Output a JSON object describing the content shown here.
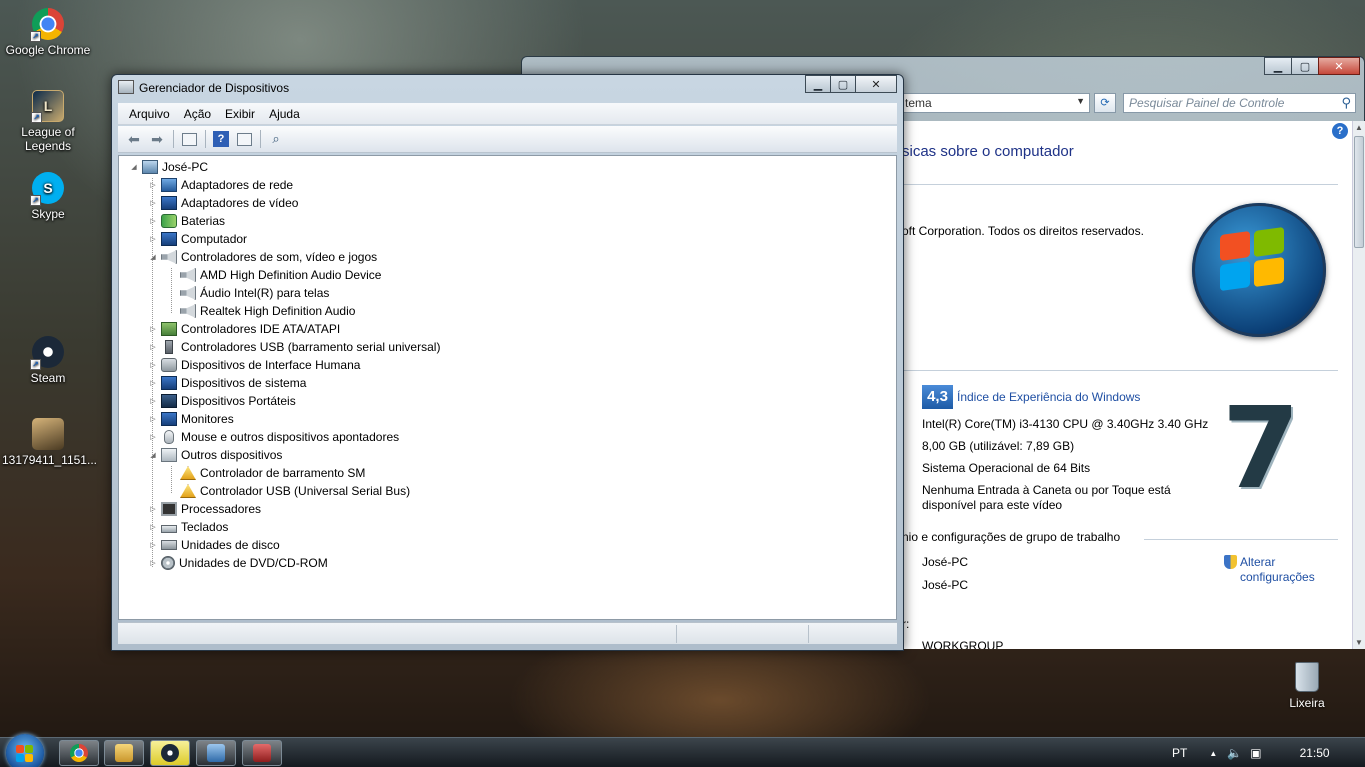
{
  "desktop": {
    "icons": [
      {
        "label": "Google Chrome",
        "icon": "chrome-icon"
      },
      {
        "label": "League of Legends",
        "icon": "league-of-legends-icon"
      },
      {
        "label": "Skype",
        "icon": "skype-icon"
      },
      {
        "label": "Steam",
        "icon": "steam-icon"
      },
      {
        "label": "13179411_1151...",
        "icon": "image-file-icon"
      }
    ],
    "recycle_bin": {
      "label": "Lixeira",
      "icon": "recycle-bin-icon"
    }
  },
  "system_window": {
    "address": "tema",
    "search_placeholder": "Pesquisar Painel de Controle",
    "heading": "sicas sobre o computador",
    "copyright": "oft Corporation. Todos os direitos reservados.",
    "wei_score": "4,3",
    "wei_link": "Índice de Experiência do Windows",
    "processor": "Intel(R) Core(TM) i3-4130 CPU @ 3.40GHz   3.40 GHz",
    "memory": "8,00 GB (utilizável: 7,89 GB)",
    "system_type": "Sistema Operacional de 64 Bits",
    "pen_touch_line1": "Nenhuma Entrada à Caneta ou por Toque está",
    "pen_touch_line2": "disponível para este vídeo",
    "group_section": "nio e configurações de grupo de trabalho",
    "computer_name": "José-PC",
    "full_name": "José-PC",
    "change_settings_line1": "Alterar",
    "change_settings_line2": "configurações",
    "workgroup_label": "r:",
    "workgroup": "WORKGROUP",
    "help_icon": "help-icon"
  },
  "device_manager": {
    "title": "Gerenciador de Dispositivos",
    "menu": [
      "Arquivo",
      "Ação",
      "Exibir",
      "Ajuda"
    ],
    "tree_root": "José-PC",
    "categories": [
      {
        "label": "Adaptadores de rede",
        "icon": "network-adapter-icon",
        "expanded": false
      },
      {
        "label": "Adaptadores de vídeo",
        "icon": "display-adapter-icon",
        "expanded": false
      },
      {
        "label": "Baterias",
        "icon": "battery-icon",
        "expanded": false
      },
      {
        "label": "Computador",
        "icon": "computer-icon",
        "expanded": false
      },
      {
        "label": "Controladores de som, vídeo e jogos",
        "icon": "speaker-icon",
        "expanded": true,
        "children": [
          {
            "label": "AMD High Definition Audio Device",
            "icon": "speaker-icon"
          },
          {
            "label": "Áudio Intel(R) para telas",
            "icon": "speaker-icon"
          },
          {
            "label": "Realtek High Definition Audio",
            "icon": "speaker-icon"
          }
        ]
      },
      {
        "label": "Controladores IDE ATA/ATAPI",
        "icon": "ide-controller-icon",
        "expanded": false
      },
      {
        "label": "Controladores USB (barramento serial universal)",
        "icon": "usb-icon",
        "expanded": false
      },
      {
        "label": "Dispositivos de Interface Humana",
        "icon": "hid-icon",
        "expanded": false
      },
      {
        "label": "Dispositivos de sistema",
        "icon": "system-device-icon",
        "expanded": false
      },
      {
        "label": "Dispositivos Portáteis",
        "icon": "portable-device-icon",
        "expanded": false
      },
      {
        "label": "Monitores",
        "icon": "monitor-icon",
        "expanded": false
      },
      {
        "label": "Mouse e outros dispositivos apontadores",
        "icon": "mouse-icon",
        "expanded": false
      },
      {
        "label": "Outros dispositivos",
        "icon": "unknown-device-icon",
        "expanded": true,
        "children": [
          {
            "label": "Controlador de barramento SM",
            "icon": "warning-device-icon"
          },
          {
            "label": "Controlador USB (Universal Serial Bus)",
            "icon": "warning-device-icon"
          }
        ]
      },
      {
        "label": "Processadores",
        "icon": "processor-icon",
        "expanded": false
      },
      {
        "label": "Teclados",
        "icon": "keyboard-icon",
        "expanded": false
      },
      {
        "label": "Unidades de disco",
        "icon": "disk-drive-icon",
        "expanded": false
      },
      {
        "label": "Unidades de DVD/CD-ROM",
        "icon": "dvd-drive-icon",
        "expanded": false
      }
    ]
  },
  "taskbar": {
    "apps": [
      "chrome-icon",
      "explorer-icon",
      "steam-icon",
      "control-panel-icon",
      "device-manager-icon"
    ],
    "language": "PT",
    "time": "21:50"
  }
}
